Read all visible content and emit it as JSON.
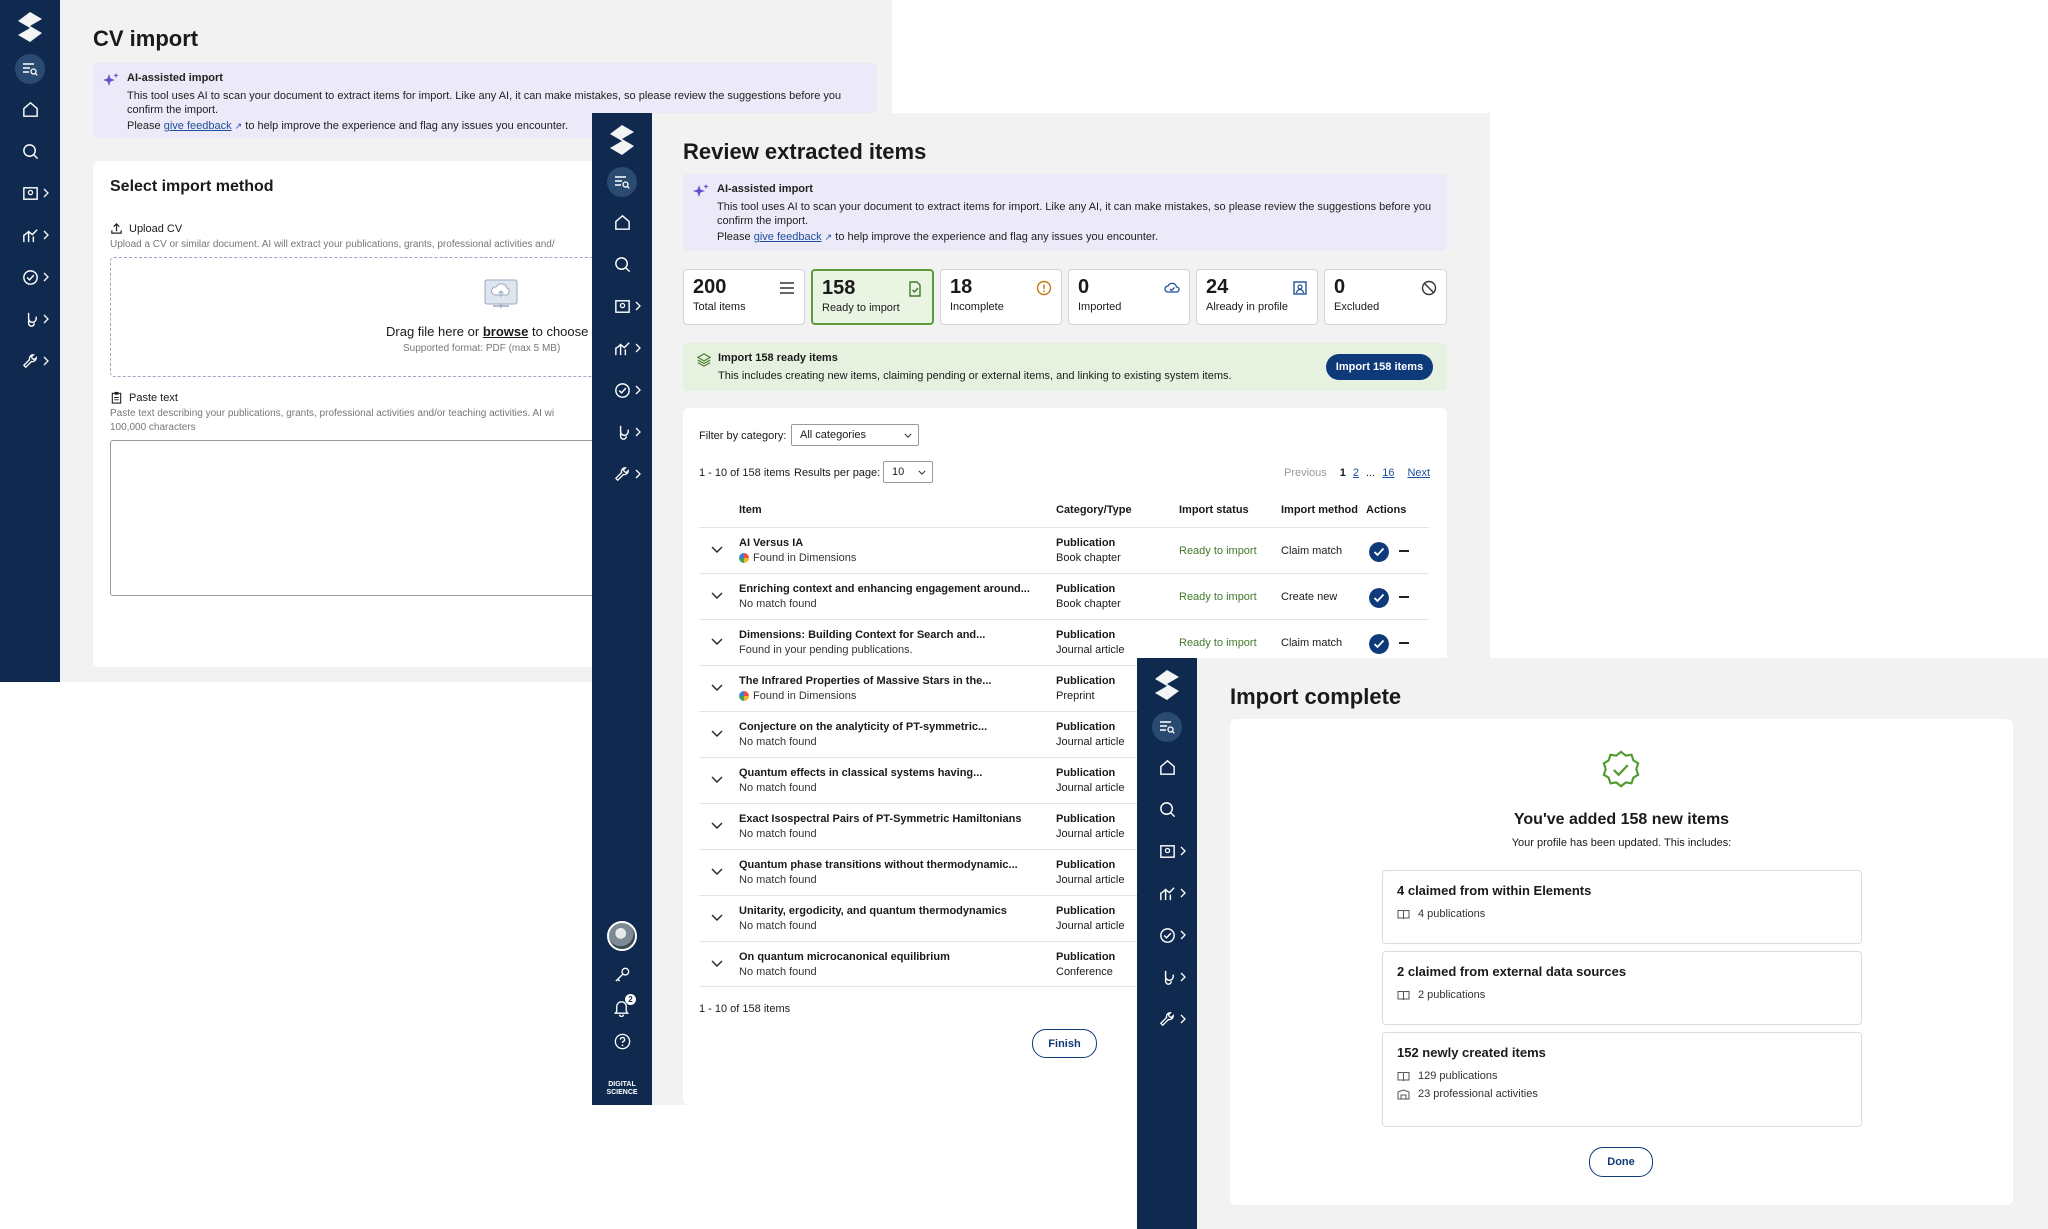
{
  "cv_import": {
    "title": "CV import",
    "ai": {
      "title": "AI-assisted import",
      "text": "This tool uses AI to scan your document to extract items for import. Like any AI, it can make mistakes, so please review the suggestions before you confirm the import.",
      "prefix": "Please",
      "link": "give feedback",
      "suffix": "to help improve the experience and flag any issues you encounter."
    },
    "method_title": "Select import method",
    "upload_label": "Upload CV",
    "upload_desc": "Upload a CV or similar document. AI will extract your publications, grants, professional activities and/",
    "drop_prefix": "Drag file here or",
    "drop_browse": "browse",
    "drop_suffix": "to choose",
    "drop_format": "Supported format: PDF (max 5 MB)",
    "paste_label": "Paste text",
    "paste_desc": "Paste text describing your publications, grants, professional activities and/or teaching activities. AI wi",
    "paste_limit": "100,000 characters"
  },
  "review": {
    "title": "Review extracted items",
    "ai": {
      "title": "AI-assisted import",
      "text": "This tool uses AI to scan your document to extract items for import. Like any AI, it can make mistakes, so please review the suggestions before you confirm the import.",
      "prefix": "Please",
      "link": "give feedback",
      "suffix": "to help improve the experience and flag any issues you encounter."
    },
    "stats": [
      {
        "num": "200",
        "label": "Total items",
        "icon": "list-icon"
      },
      {
        "num": "158",
        "label": "Ready to import",
        "icon": "file-check-icon"
      },
      {
        "num": "18",
        "label": "Incomplete",
        "icon": "warning-icon"
      },
      {
        "num": "0",
        "label": "Imported",
        "icon": "cloud-check-icon"
      },
      {
        "num": "24",
        "label": "Already in profile",
        "icon": "profile-icon"
      },
      {
        "num": "0",
        "label": "Excluded",
        "icon": "ban-icon"
      }
    ],
    "ready_banner": {
      "title": "Import 158 ready items",
      "text": "This includes creating new items, claiming pending or external items, and linking to existing system items.",
      "button": "Import 158 items"
    },
    "filter_label": "Filter by category:",
    "filter_value": "All categories",
    "range": "1 - 10 of 158 items",
    "per_page_label": "Results per page:",
    "per_page_value": "10",
    "pagination": {
      "prev": "Previous",
      "p1": "1",
      "p2": "2",
      "ellipsis": "...",
      "p16": "16",
      "next": "Next"
    },
    "columns": {
      "item": "Item",
      "category": "Category/Type",
      "status": "Import status",
      "method": "Import method",
      "actions": "Actions"
    },
    "rows": [
      {
        "title": "AI Versus IA",
        "sub": "Found in Dimensions",
        "cat": "Publication",
        "type": "Book chapter",
        "status": "Ready to import",
        "method": "Claim match"
      },
      {
        "title": "Enriching context and enhancing engagement around...",
        "sub": "No match found",
        "cat": "Publication",
        "type": "Book chapter",
        "status": "Ready to import",
        "method": "Create new"
      },
      {
        "title": "Dimensions: Building Context for Search and...",
        "sub": "Found in your pending publications.",
        "cat": "Publication",
        "type": "Journal article",
        "status": "Ready to import",
        "method": "Claim match"
      },
      {
        "title": "The Infrared Properties of Massive Stars in the...",
        "sub": "Found in Dimensions",
        "cat": "Publication",
        "type": "Preprint",
        "status": "",
        "method": ""
      },
      {
        "title": "Conjecture on the analyticity of PT-symmetric...",
        "sub": "No match found",
        "cat": "Publication",
        "type": "Journal article",
        "status": "",
        "method": ""
      },
      {
        "title": "Quantum effects in classical systems having...",
        "sub": "No match found",
        "cat": "Publication",
        "type": "Journal article",
        "status": "",
        "method": ""
      },
      {
        "title": "Exact Isospectral Pairs of PT-Symmetric Hamiltonians",
        "sub": "No match found",
        "cat": "Publication",
        "type": "Journal article",
        "status": "",
        "method": ""
      },
      {
        "title": "Quantum phase transitions without thermodynamic...",
        "sub": "No match found",
        "cat": "Publication",
        "type": "Journal article",
        "status": "",
        "method": ""
      },
      {
        "title": "Unitarity, ergodicity, and quantum thermodynamics",
        "sub": "No match found",
        "cat": "Publication",
        "type": "Journal article",
        "status": "",
        "method": ""
      },
      {
        "title": "On quantum microcanonical equilibrium",
        "sub": "No match found",
        "cat": "Publication",
        "type": "Conference",
        "status": "",
        "method": ""
      }
    ],
    "range_bottom": "1 - 10 of 158 items",
    "finish": "Finish",
    "notification_count": "2",
    "brand_line1": "DIGITAL",
    "brand_line2": "SCIENCE"
  },
  "complete": {
    "title": "Import complete",
    "headline": "You've added 158 new items",
    "subline": "Your profile has been updated. This includes:",
    "boxes": [
      {
        "title": "4 claimed from within Elements",
        "lines": [
          "4 publications"
        ]
      },
      {
        "title": "2 claimed from external data sources",
        "lines": [
          "2 publications"
        ]
      },
      {
        "title": "152 newly created items",
        "lines": [
          "129 publications",
          "23 professional activities"
        ]
      }
    ],
    "done": "Done"
  },
  "colors": {
    "sidebar": "#0f2a4e",
    "primary": "#0f3a7a",
    "success": "#5d9a3b",
    "ai_bg": "#ece9f8"
  }
}
